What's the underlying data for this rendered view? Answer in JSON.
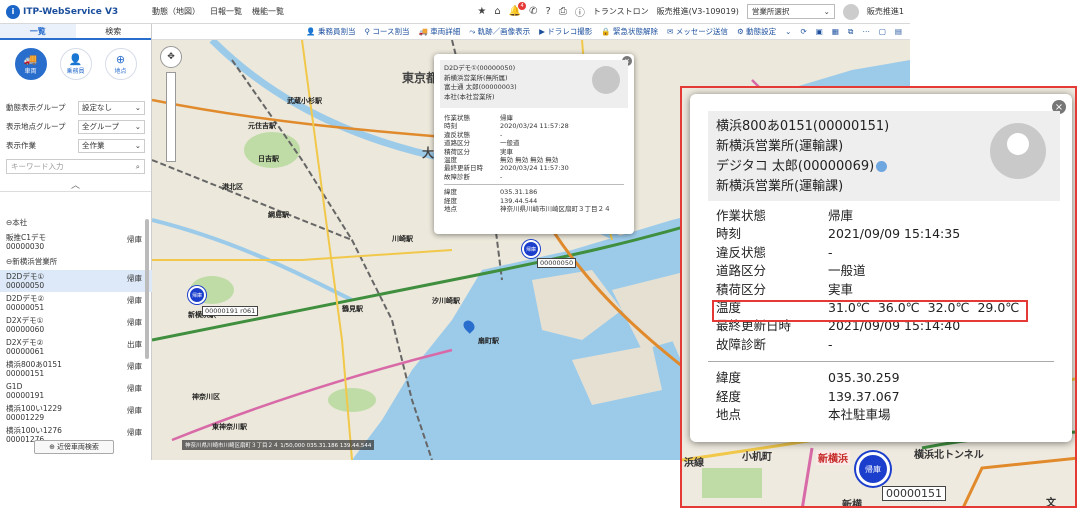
{
  "header": {
    "logo": "ITP-WebService V3",
    "nav": [
      "動態（地図）",
      "日報一覧",
      "機能一覧"
    ],
    "company": "トランストロン",
    "user_info": "販売推進(V3-109019)",
    "office_select": "営業所選択",
    "user_name": "販売推進1",
    "notification_count": "4"
  },
  "sidebar": {
    "tabs": [
      "一覧",
      "検索"
    ],
    "modes": [
      "車両",
      "乗務員",
      "地点"
    ],
    "filters": [
      {
        "label": "動態表示グループ",
        "value": "設定なし"
      },
      {
        "label": "表示地点グループ",
        "value": "全グループ"
      },
      {
        "label": "表示作業",
        "value": "全作業"
      }
    ],
    "keyword_placeholder": "キーワード入力",
    "groups": [
      {
        "name": "⊖本社",
        "items": [
          {
            "name": "販推C1デモ",
            "id": "00000030",
            "status": "帰庫"
          }
        ]
      },
      {
        "name": "⊖新横浜営業所",
        "items": [
          {
            "name": "D2Dデモ①",
            "id": "00000050",
            "status": "帰庫"
          },
          {
            "name": "D2Dデモ②",
            "id": "00000051",
            "status": "帰庫"
          },
          {
            "name": "D2Xデモ①",
            "id": "00000060",
            "status": "帰庫"
          },
          {
            "name": "D2Xデモ②",
            "id": "00000061",
            "status": "出庫"
          },
          {
            "name": "横浜800あ0151",
            "id": "00000151",
            "status": "帰庫"
          },
          {
            "name": "G1D",
            "id": "00000191",
            "status": "帰庫"
          },
          {
            "name": "横浜100い1229",
            "id": "00001229",
            "status": "帰庫"
          },
          {
            "name": "横浜100い1276",
            "id": "00001276",
            "status": "帰庫"
          }
        ]
      }
    ],
    "near_button": "近傍車両検索"
  },
  "toolbar": {
    "items": [
      "乗務員割当",
      "コース割当",
      "車両詳細",
      "軌跡／画像表示",
      "ドラレコ撮影",
      "緊急状態解除",
      "メッセージ送信",
      "動態設定"
    ]
  },
  "map": {
    "labels": [
      "武蔵小杉駅",
      "元住吉駅",
      "日吉駅",
      "港北区",
      "綱島駅",
      "新横浜駅",
      "東京都",
      "大田区",
      "川崎駅",
      "鶴見駅",
      "汐川崎駅",
      "扇町駅",
      "東神奈川駅",
      "神奈川区"
    ],
    "marker_status": "帰庫",
    "marker_labels": [
      "00000050",
      "00000191 r061"
    ],
    "status_bar": "神奈川県川崎市川崎区扇町３丁目２４ 1/50,000 035.31.186 139.44.544"
  },
  "popup_small": {
    "lines": [
      "D2Dデモ①(00000050)",
      "新横浜営業所(無所属)",
      "富士通 太郎(00000003)",
      "本社(本社営業所)"
    ],
    "rows": [
      {
        "k": "作業状態",
        "v": "帰庫"
      },
      {
        "k": "時刻",
        "v": "2020/03/24 11:57:28"
      },
      {
        "k": "違反状態",
        "v": "-"
      },
      {
        "k": "道路区分",
        "v": "一般道"
      },
      {
        "k": "積荷区分",
        "v": "実車"
      },
      {
        "k": "温度",
        "v": "無効 無効 無効 無効"
      },
      {
        "k": "最終更新日時",
        "v": "2020/03/24 11:57:30"
      },
      {
        "k": "故障診断",
        "v": "-"
      }
    ],
    "pos": [
      {
        "k": "緯度",
        "v": "035.31.186"
      },
      {
        "k": "経度",
        "v": "139.44.544"
      },
      {
        "k": "地点",
        "v": "神奈川県川崎市川崎区扇町３丁目２４"
      }
    ]
  },
  "popup_large": {
    "lines": [
      "横浜800あ0151(00000151)",
      "新横浜営業所(運輸課)",
      "デジタコ 太郎(00000069)",
      "新横浜営業所(運輸課)"
    ],
    "rows": [
      {
        "k": "作業状態",
        "v": "帰庫"
      },
      {
        "k": "時刻",
        "v": "2021/09/09 15:14:35"
      },
      {
        "k": "違反状態",
        "v": "-"
      },
      {
        "k": "道路区分",
        "v": "一般道"
      },
      {
        "k": "積荷区分",
        "v": "実車"
      },
      {
        "k": "温度",
        "v": "31.0℃  36.0℃  32.0℃  29.0℃"
      },
      {
        "k": "最終更新日時",
        "v": "2021/09/09 15:14:40"
      },
      {
        "k": "故障診断",
        "v": "-"
      }
    ],
    "pos": [
      {
        "k": "緯度",
        "v": "035.30.259"
      },
      {
        "k": "経度",
        "v": "139.37.067"
      },
      {
        "k": "地点",
        "v": "本社駐車場"
      }
    ],
    "map_labels": [
      "浜線",
      "小机町",
      "新横浜",
      "横浜北トンネル",
      "新横",
      "文"
    ],
    "marker_status": "帰庫",
    "marker_label": "00000151"
  }
}
